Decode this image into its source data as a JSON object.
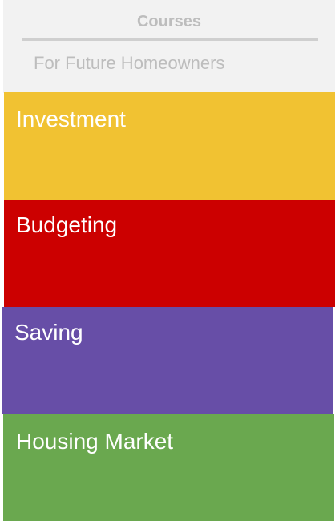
{
  "header": {
    "title": "Courses",
    "subtitle": "For Future Homeowners"
  },
  "courses": [
    {
      "label": "Investment",
      "color": "#f1c232"
    },
    {
      "label": "Budgeting",
      "color": "#cc0000"
    },
    {
      "label": "Saving",
      "color": "#674ea7"
    },
    {
      "label": "Housing Market",
      "color": "#6aa84f"
    }
  ]
}
